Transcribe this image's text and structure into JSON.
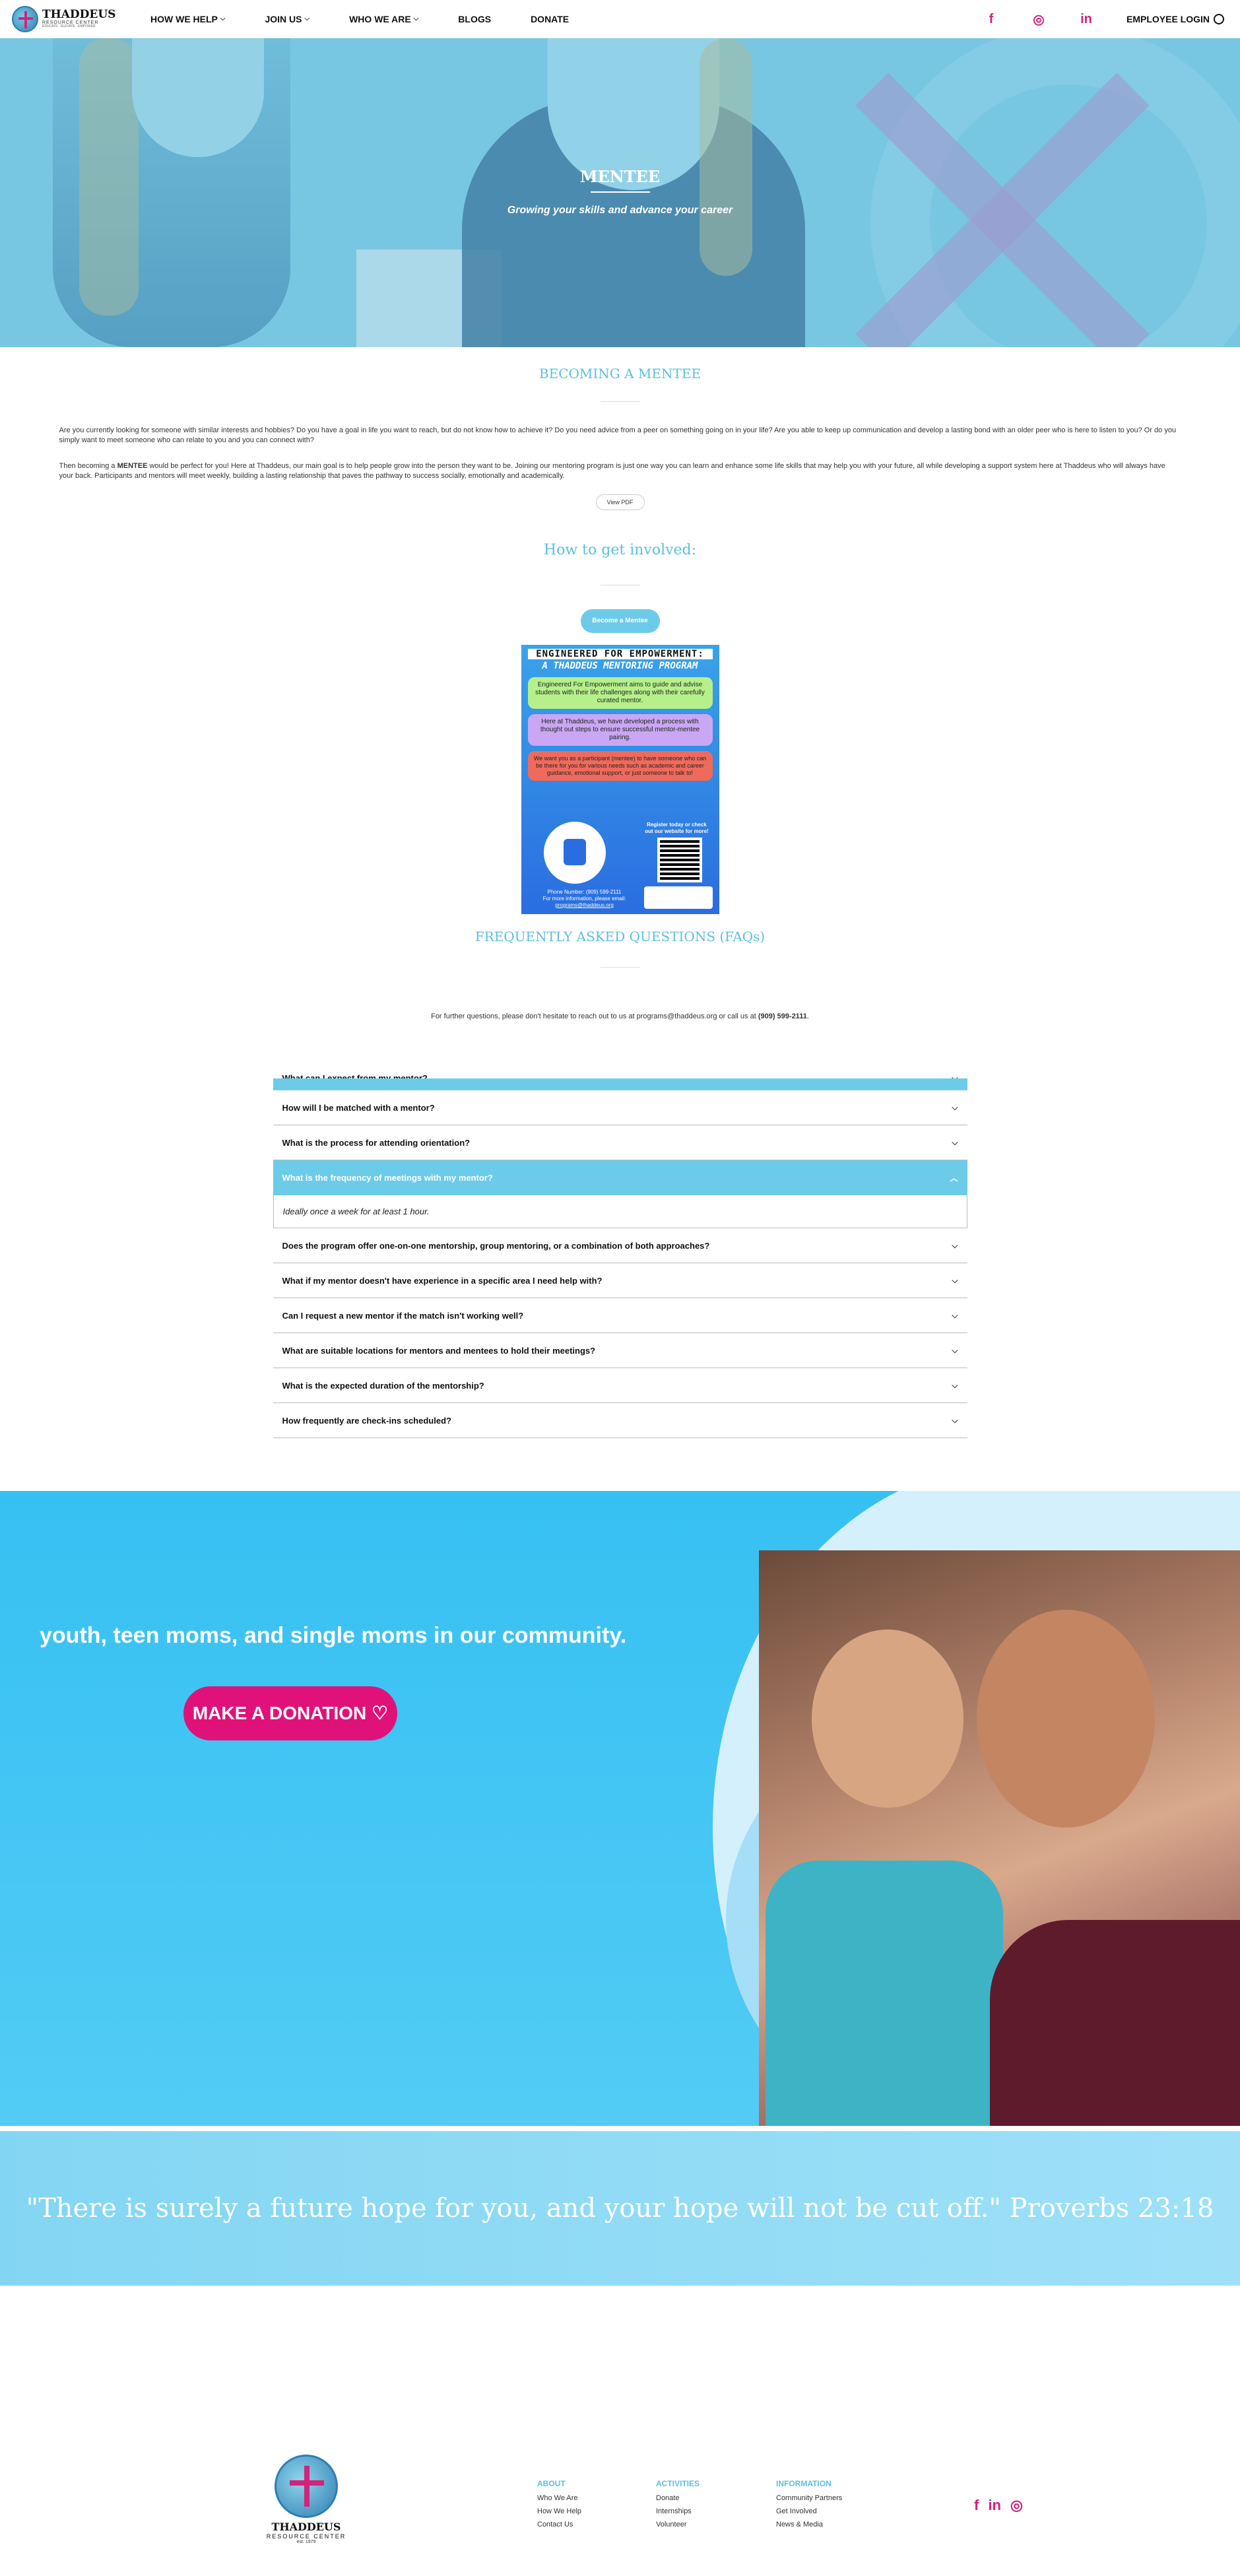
{
  "nav": {
    "logo_name": "THADDEUS",
    "logo_sub": "RESOURCE CENTER",
    "logo_tag": "EDUCATE · ELEVATE · EMPOWER",
    "items": [
      {
        "label": "HOW WE HELP",
        "dropdown": true
      },
      {
        "label": "JOIN US",
        "dropdown": true
      },
      {
        "label": "WHO WE ARE",
        "dropdown": true
      },
      {
        "label": "BLOGS",
        "dropdown": false
      },
      {
        "label": "DONATE",
        "dropdown": false
      }
    ],
    "social": [
      {
        "name": "facebook-icon",
        "glyph": "f"
      },
      {
        "name": "instagram-icon",
        "glyph": "◎"
      },
      {
        "name": "linkedin-icon",
        "glyph": "in"
      }
    ],
    "employee_login": "EMPLOYEE LOGIN"
  },
  "hero": {
    "title": "MENTEE",
    "subtitle": "Growing your skills and advance your career"
  },
  "becoming": {
    "heading": "BECOMING A MENTEE",
    "para1": "Are you currently looking for someone with similar interests and hobbies? Do you have a goal in life you want to reach, but do not know how to achieve it? Do you need advice from a peer on something going on in your life? Are you able to keep up communication and develop a lasting bond with an older peer who is here to listen to you? Or do you simply want to meet someone who can relate to you and you can connect with?",
    "para2_pre": "Then becoming a ",
    "para2_bold": "MENTEE",
    "para2_post": " would be perfect for you! Here at Thaddeus, our main goal is to help people grow into the person they want to be. Joining our mentoring program is just one way you can learn and enhance some life skills that may help you with your future, all while developing a support system here at Thaddeus who will always have your back. Participants and mentors will meet weekly, building a lasting relationship that paves the pathway to success socially, emotionally and academically.",
    "pdf_button": "View PDF"
  },
  "involved": {
    "heading": "How to get involved:",
    "button": "Become a Mentee"
  },
  "flyer": {
    "title": "ENGINEERED FOR EMPOWERMENT:",
    "subtitle": "A THADDEUS MENTORING PROGRAM",
    "box1": "Engineered For Empowerment aims to guide and advise students with their life challenges along with their carefully curated mentor.",
    "box2": "Here at Thaddeus, we have developed a process with thought out steps to ensure successful mentor-mentee pairing.",
    "box3": "We want you as a participant (mentee) to have someone who can be there for you for various needs such as academic and career guidance, emotional support, or just someone to talk to!",
    "register": "Register today or check out our website for more!",
    "phone": "Phone Number: (909) 599-2111",
    "email_label": "For more information, please email:",
    "email": "programs@thaddeus.org"
  },
  "faq": {
    "heading": "FREQUENTLY ASKED QUESTIONS (FAQs)",
    "note_pre": "For further questions, please don't hesitate to reach out to us at programs@thaddeus.org  or call us at ",
    "note_phone": "(909) 599-2111",
    "note_post": ".",
    "items": [
      {
        "q": "What can I expect from my mentor?",
        "open": false
      },
      {
        "q": "How will I be matched with a mentor?",
        "open": false
      },
      {
        "q": "What is the process for attending orientation?",
        "open": false
      },
      {
        "q": "What is the frequency of meetings with my mentor?",
        "open": true,
        "a": "Ideally once a week for at least 1 hour."
      },
      {
        "q": "Does the program offer one-on-one mentorship, group mentoring, or a combination of both approaches?",
        "open": false
      },
      {
        "q": "What if my mentor doesn't have experience in a specific area I need help with?",
        "open": false
      },
      {
        "q": "Can I request a new mentor if the match isn't working well?",
        "open": false
      },
      {
        "q": "What are suitable locations for mentors and mentees to hold their meetings?",
        "open": false
      },
      {
        "q": "What is the expected duration of the mentorship?",
        "open": false
      },
      {
        "q": "How frequently are check-ins scheduled?",
        "open": false
      }
    ]
  },
  "donate": {
    "text": "youth, teen moms, and single moms in our community.",
    "button": "MAKE A DONATION ♡"
  },
  "quote": {
    "text": "\"There is surely a future hope for you, and your hope will not be cut off.\"  Proverbs 23:18"
  },
  "footer": {
    "logo_name": "THADDEUS",
    "logo_sub": "RESOURCE CENTER",
    "logo_est": "est. 1979",
    "columns": [
      {
        "heading": "ABOUT",
        "links": [
          "Who We Are",
          "How We Help",
          "Contact Us"
        ]
      },
      {
        "heading": "ACTIVITIES",
        "links": [
          "Donate",
          "Internships",
          "Volunteer"
        ]
      },
      {
        "heading": "INFORMATION",
        "links": [
          "Community Partners",
          "Get Involved",
          "News & Media"
        ]
      }
    ],
    "social": [
      {
        "name": "facebook-icon",
        "glyph": "f"
      },
      {
        "name": "linkedin-icon",
        "glyph": "in"
      },
      {
        "name": "instagram-icon",
        "glyph": "◎"
      }
    ]
  },
  "colors": {
    "accent": "#5bc0de",
    "brand_pink": "#d4237a",
    "donate_bg": "#36c0f2"
  }
}
